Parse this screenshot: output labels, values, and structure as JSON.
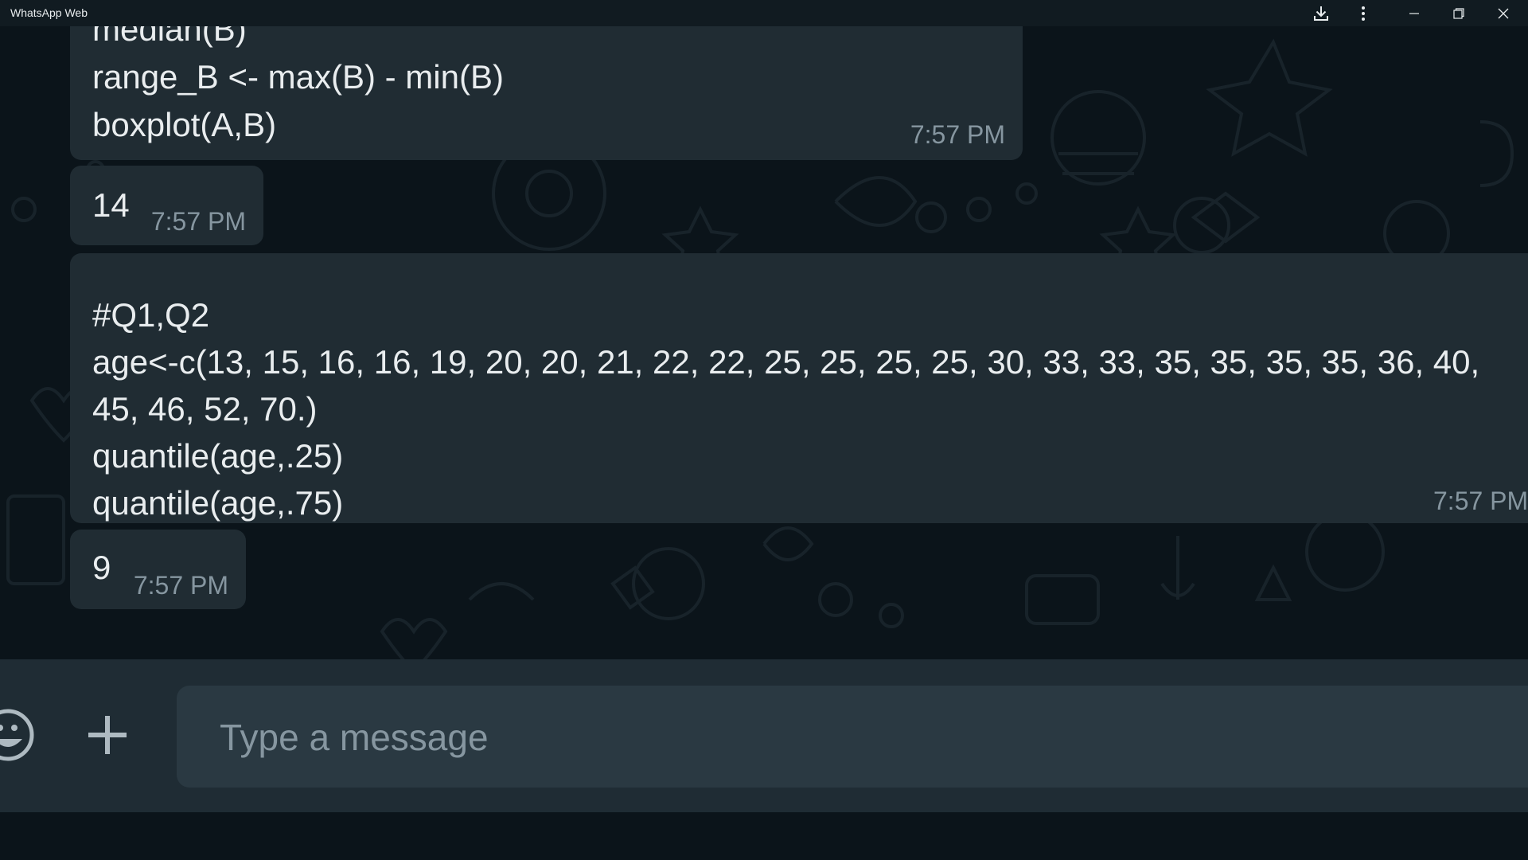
{
  "window": {
    "title": "WhatsApp Web"
  },
  "messages": [
    {
      "lines": [
        "median(B)",
        "range_B <- max(B) - min(B)",
        "boxplot(A,B)"
      ],
      "time": "7:57 PM"
    },
    {
      "lines": [
        "14"
      ],
      "time": "7:57 PM"
    },
    {
      "lines": [
        "#Q1,Q2",
        "age<-c(13, 15, 16, 16, 19, 20, 20, 21, 22, 22, 25, 25, 25, 25, 30, 33, 33, 35, 35, 35, 35, 36, 40,",
        "45, 46, 52, 70.)",
        "quantile(age,.25)",
        "quantile(age,.75)"
      ],
      "time": "7:57 PM"
    },
    {
      "lines": [
        "9"
      ],
      "time": "7:57 PM"
    }
  ],
  "composer": {
    "placeholder": "Type a message",
    "value": ""
  },
  "icons": {
    "download": "download-icon",
    "menu": "more-vertical-icon",
    "minimize": "minimize-icon",
    "restore": "restore-icon",
    "close": "close-icon",
    "emoji": "emoji-icon",
    "attach": "plus-icon"
  },
  "colors": {
    "chat_background": "#0b141a",
    "bubble": "#202c33",
    "composer_bar": "#1f2c34",
    "input": "#2a3942",
    "text": "#e9edef",
    "meta_text": "#8696a0"
  }
}
